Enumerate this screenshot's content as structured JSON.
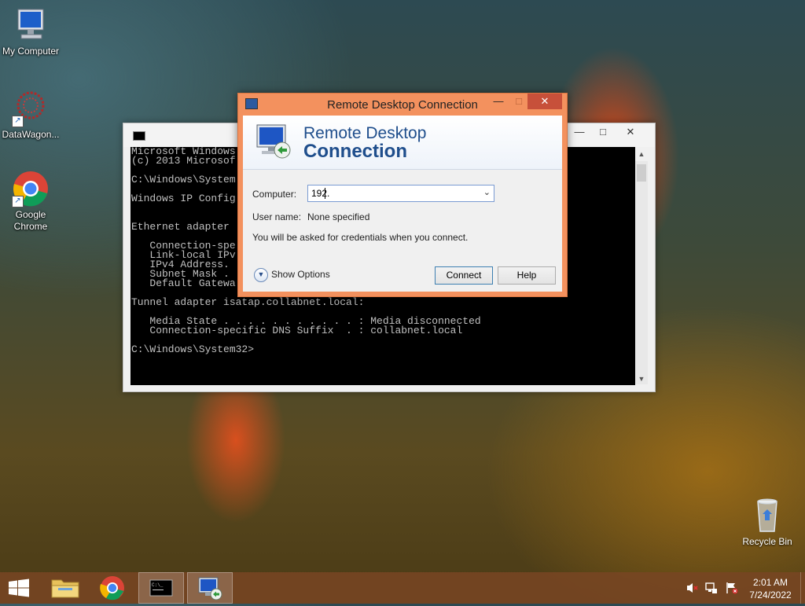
{
  "desktop": {
    "icons": [
      {
        "label": "My Computer"
      },
      {
        "label": "DataWagon..."
      },
      {
        "label_line1": "Google",
        "label_line2": "Chrome"
      },
      {
        "label": "Recycle Bin"
      }
    ]
  },
  "cmd_window": {
    "lines": "Microsoft Windows\n(c) 2013 Microsof\n\nC:\\Windows\\System\n\nWindows IP Config\n\n\nEthernet adapter\n\n   Connection-spe\n   Link-local IPv\n   IPv4 Address.\n   Subnet Mask .\n   Default Gatewa\n\nTunnel adapter isatap.collabnet.local:\n\n   Media State . . . . . . . . . . . : Media disconnected\n   Connection-specific DNS Suffix  . : collabnet.local\n\nC:\\Windows\\System32>"
  },
  "rdc_window": {
    "title": "Remote Desktop Connection",
    "banner_line1": "Remote Desktop",
    "banner_line2": "Connection",
    "computer_label": "Computer:",
    "computer_value": "192.",
    "username_label": "User name:",
    "username_value": "None specified",
    "info_text": "You will be asked for credentials when you connect.",
    "show_options": "Show Options",
    "connect_button": "Connect",
    "help_button": "Help"
  },
  "taskbar": {
    "time": "2:01 AM",
    "date": "7/24/2022"
  },
  "colors": {
    "rdc_frame": "#f3915e",
    "close_button": "#c7503a",
    "banner_text": "#1f4e8c",
    "taskbar": "#784623"
  }
}
